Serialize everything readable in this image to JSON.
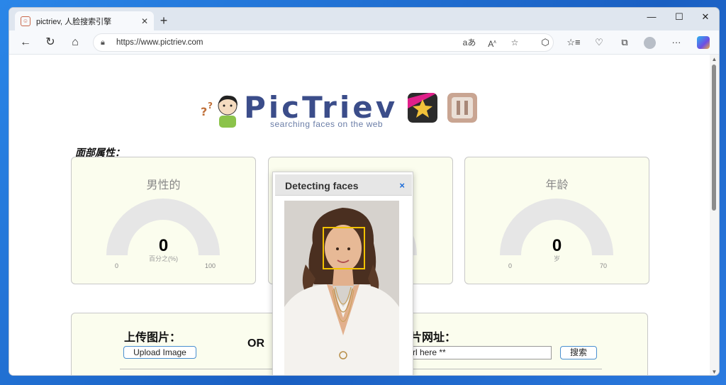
{
  "browser": {
    "tab_title": "pictriev, 人脸搜索引擎",
    "tab_favicon": "face-favicon",
    "url_scheme": "https://",
    "url_host": "www.pictriev.com",
    "icons": [
      "back-icon",
      "refresh-icon",
      "home-icon",
      "lock-icon",
      "read-aloud-icon",
      "text-size-icon",
      "favorite-icon",
      "extensions-icon",
      "favorites-bar-icon",
      "browser-essentials-icon",
      "collections-icon",
      "profile-icon",
      "more-icon",
      "copilot-icon"
    ],
    "window_controls": [
      "minimize",
      "maximize",
      "close"
    ]
  },
  "logo": {
    "title": "PicTriev",
    "tagline": "searching faces on the web",
    "brand_color": "#3b4d8a"
  },
  "attributes": {
    "heading": "面部属性：",
    "cards": [
      {
        "title": "男性的",
        "value": "0",
        "unit": "百分之(%)",
        "min": "0",
        "max": "100"
      },
      {
        "title": "",
        "value": "",
        "unit": "",
        "min": "",
        "max": ""
      },
      {
        "title": "年龄",
        "value": "0",
        "unit": "岁",
        "min": "0",
        "max": "70"
      }
    ],
    "card_bg": "#fbfdee",
    "gauge_color": "#e6e6e6"
  },
  "upload": {
    "upload_label": "上传图片：",
    "upload_button": "Upload Image",
    "or": "OR",
    "url_label": "片网址：",
    "url_value": "rl here **",
    "search_button": "搜索"
  },
  "modal": {
    "title": "Detecting faces",
    "close": "×",
    "face_box_color": "#f2c200"
  }
}
